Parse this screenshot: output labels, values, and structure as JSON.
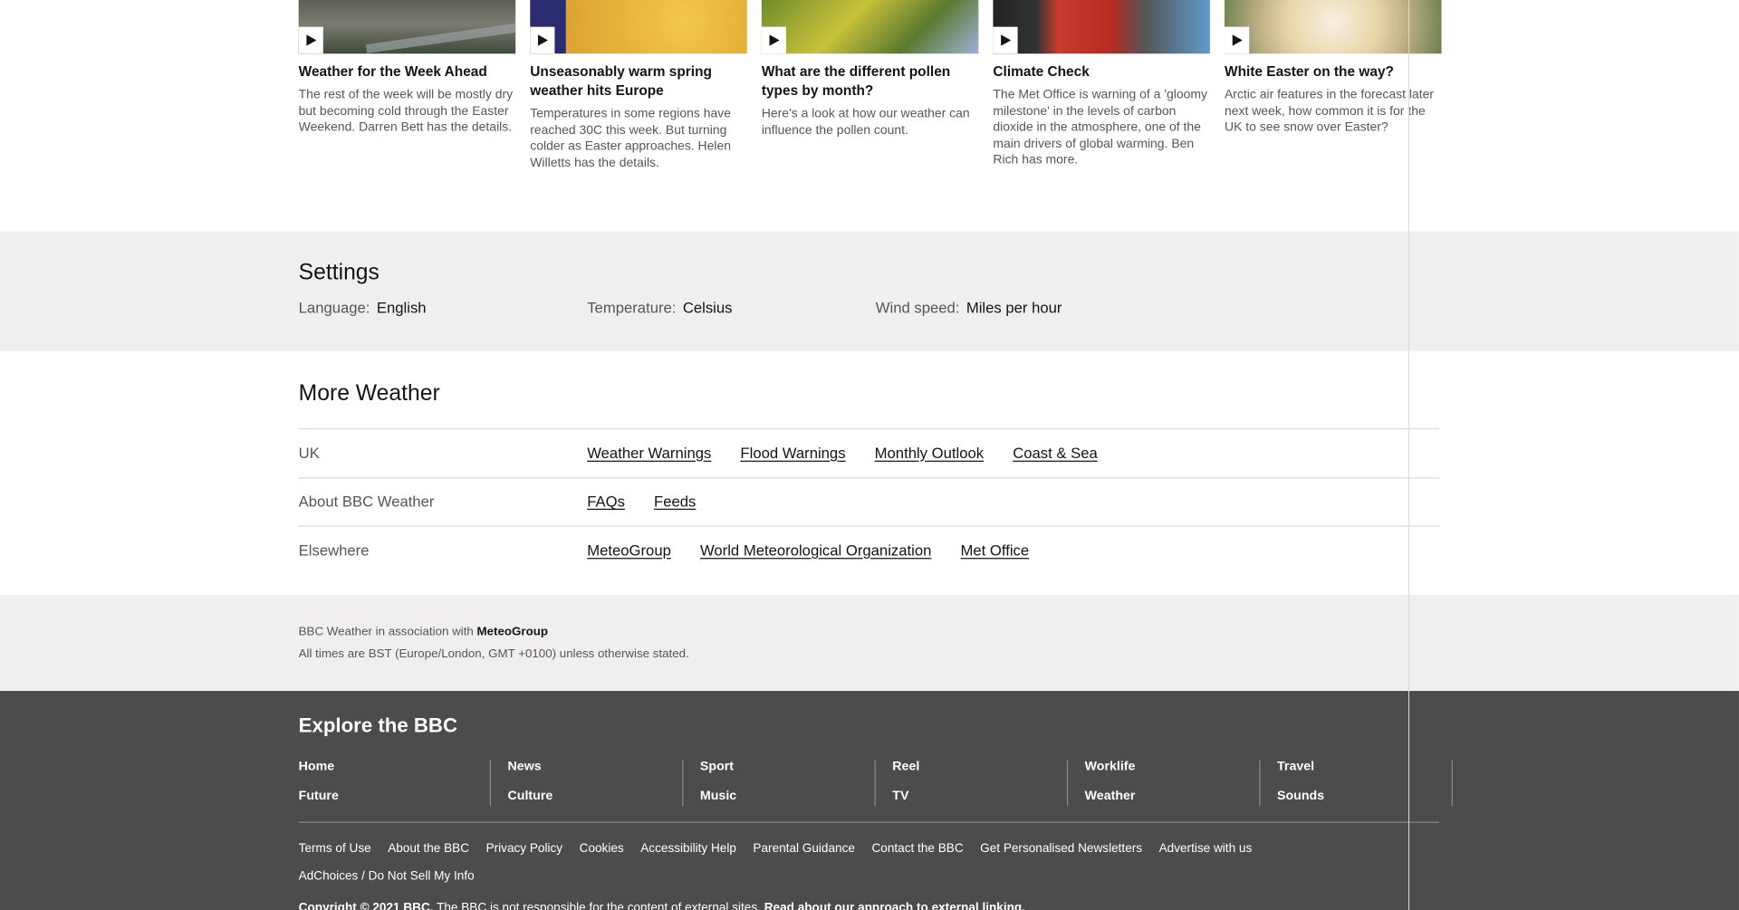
{
  "videos": [
    {
      "title": "Weather for the Week Ahead",
      "desc": "The rest of the week will be mostly dry but becoming cold through the Easter Weekend. Darren Bett has the details."
    },
    {
      "title": "Unseasonably warm spring weather hits Europe",
      "desc": "Temperatures in some regions have reached 30C this week. But turning colder as Easter approaches. Helen Willetts has the details."
    },
    {
      "title": "What are the different pollen types by month?",
      "desc": "Here's a look at how our weather can influence the pollen count."
    },
    {
      "title": "Climate Check",
      "desc": "The Met Office is warning of a 'gloomy milestone' in the levels of carbon dioxide in the atmosphere, one of the main drivers of global warming. Ben Rich has more."
    },
    {
      "title": "White Easter on the way?",
      "desc": "Arctic air features in the forecast later next week, how common it is for the UK to see snow over Easter?"
    }
  ],
  "settings": {
    "title": "Settings",
    "language_label": "Language:",
    "language_value": "English",
    "temperature_label": "Temperature:",
    "temperature_value": "Celsius",
    "wind_label": "Wind speed:",
    "wind_value": "Miles per hour"
  },
  "more_weather": {
    "title": "More Weather",
    "rows": [
      {
        "head": "UK",
        "links": [
          "Weather Warnings",
          "Flood Warnings",
          "Monthly Outlook",
          "Coast & Sea"
        ]
      },
      {
        "head": "About BBC Weather",
        "links": [
          "FAQs",
          "Feeds"
        ]
      },
      {
        "head": "Elsewhere",
        "links": [
          "MeteoGroup",
          "World Meteorological Organization",
          "Met Office"
        ]
      }
    ]
  },
  "attribution": {
    "line1_prefix": "BBC Weather in association with",
    "line1_brand": "MeteoGroup",
    "line2": "All times are BST (Europe/London, GMT +0100) unless otherwise stated."
  },
  "footer": {
    "title": "Explore the BBC",
    "columns": [
      [
        "Home",
        "Future"
      ],
      [
        "News",
        "Culture"
      ],
      [
        "Sport",
        "Music"
      ],
      [
        "Reel",
        "TV"
      ],
      [
        "Worklife",
        "Weather"
      ],
      [
        "Travel",
        "Sounds"
      ]
    ],
    "legal_links": [
      "Terms of Use",
      "About the BBC",
      "Privacy Policy",
      "Cookies",
      "Accessibility Help",
      "Parental Guidance",
      "Contact the BBC",
      "Get Personalised Newsletters",
      "Advertise with us"
    ],
    "adchoices": "AdChoices / Do Not Sell My Info",
    "copyright_bold": "Copyright © 2021 BBC.",
    "copyright_text": "The BBC is not responsible for the content of external sites.",
    "copyright_link": "Read about our approach to external linking."
  }
}
